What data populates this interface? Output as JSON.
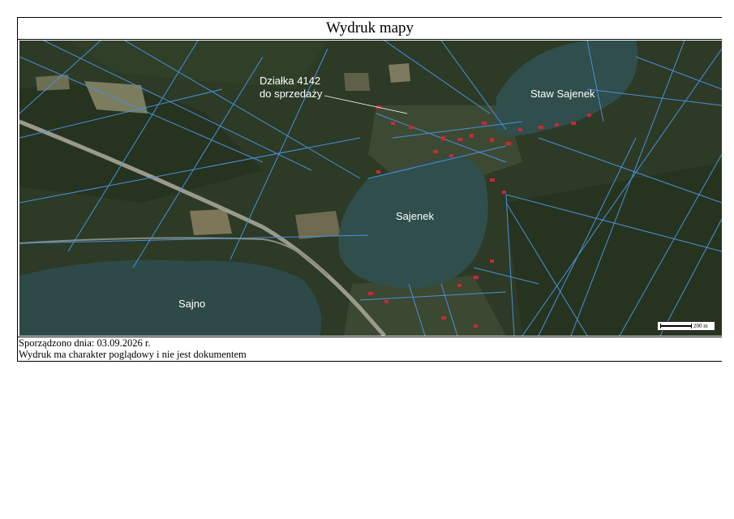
{
  "header": {
    "title": "Wydruk mapy"
  },
  "map": {
    "labels": {
      "parcel_line1": "Działka 4142",
      "parcel_line2": "do sprzedaży",
      "lake_staw_sajenek": "Staw Sajenek",
      "lake_sajenek": "Sajenek",
      "lake_sajno": "Sajno"
    },
    "scale_bar_text": "200 m",
    "colors": {
      "forest": "#2c3a26",
      "water": "#2f4e4c",
      "parcel_lines": "#4a90d9",
      "buildings": "#c8283a"
    }
  },
  "footer": {
    "date_line": "Sporządzono dnia: 03.09.2026 r.",
    "disclaimer": "Wydruk ma charakter poglądowy i nie jest dokumentem"
  }
}
